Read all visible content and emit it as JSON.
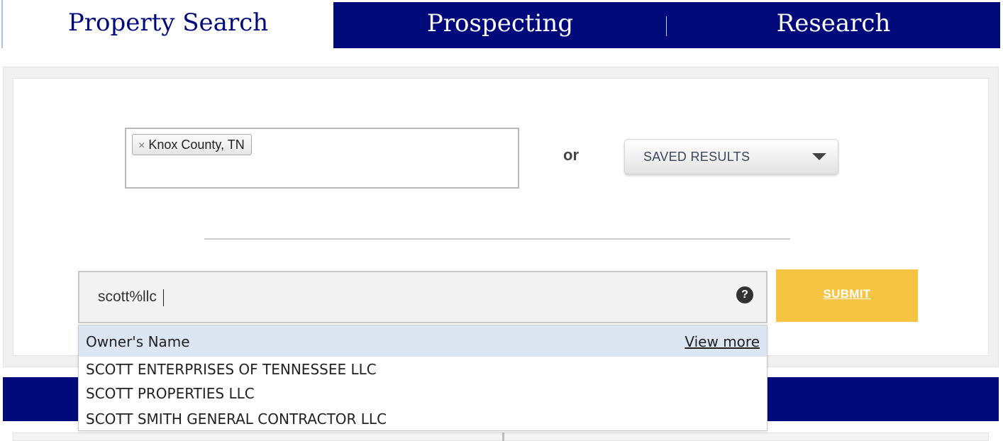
{
  "tabs": {
    "active": "Property Search",
    "items": [
      "Prospecting",
      "Research"
    ]
  },
  "location": {
    "chip_remove": "×",
    "chip_label": "Knox County, TN"
  },
  "or_label": "or",
  "saved_results": {
    "label": "SAVED RESULTS"
  },
  "search": {
    "value": "scott%llc",
    "help": "?"
  },
  "submit_label": "SUBMIT",
  "autocomplete": {
    "category": "Owner's Name",
    "view_more": "View more",
    "results": [
      "SCOTT ENTERPRISES OF TENNESSEE LLC",
      "SCOTT PROPERTIES LLC",
      "SCOTT SMITH GENERAL CONTRACTOR LLC"
    ]
  },
  "colors": {
    "brand_navy": "#000a7a",
    "submit_yellow": "#f6c443",
    "dropdown_header": "#dbe6f2"
  }
}
